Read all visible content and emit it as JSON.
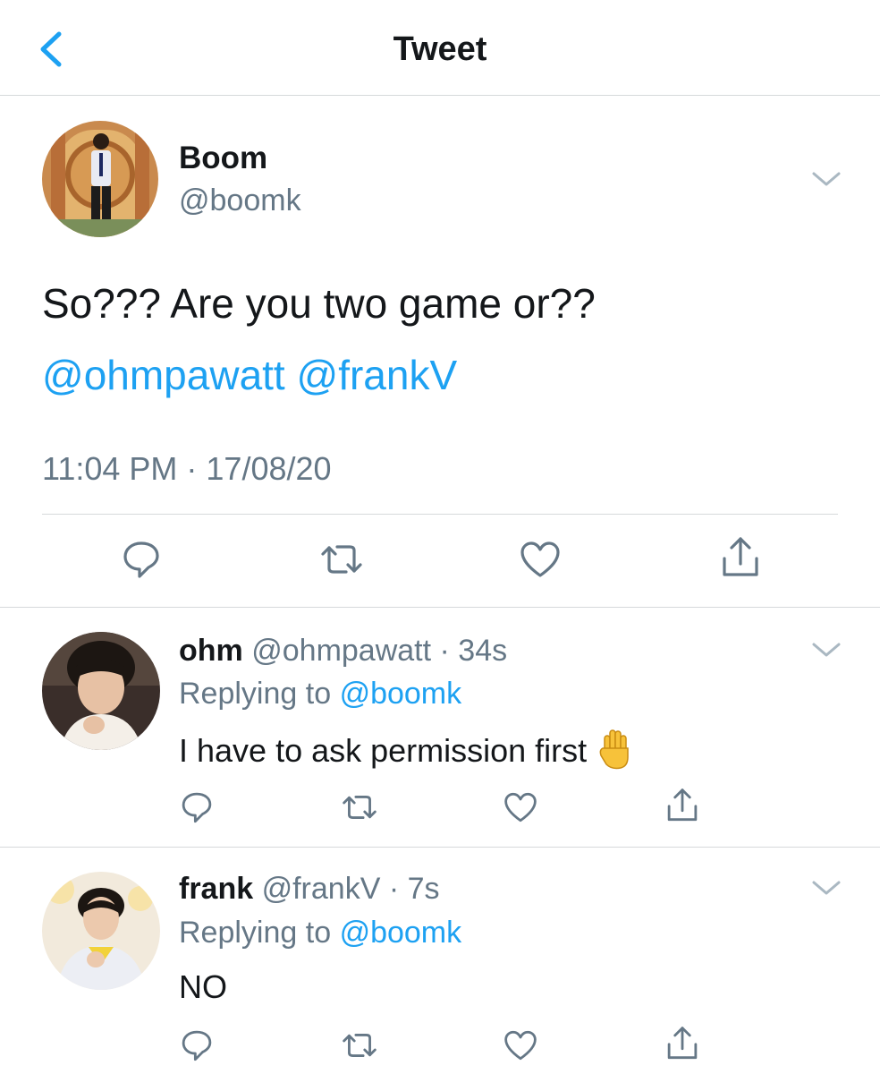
{
  "header": {
    "title": "Tweet",
    "back_icon": "chevron-left-icon"
  },
  "main_tweet": {
    "name": "Boom",
    "handle": "@boomk",
    "text": "So??? Are you two game or??",
    "mentions": [
      "@ohmpawatt",
      "@frankV"
    ],
    "timestamp": "11:04 PM · 17/08/20"
  },
  "actions": [
    "reply-icon",
    "retweet-icon",
    "like-icon",
    "share-icon"
  ],
  "replies": [
    {
      "name": "ohm",
      "handle": "@ohmpawatt",
      "time": "34s",
      "replying_label": "Replying to",
      "replying_to": "@boomk",
      "text": "I have to ask permission first",
      "emoji": "raised-hand-emoji"
    },
    {
      "name": "frank",
      "handle": "@frankV",
      "time": "7s",
      "replying_label": "Replying to",
      "replying_to": "@boomk",
      "text": "NO"
    }
  ],
  "colors": {
    "accent": "#1da1f2",
    "muted": "#657786",
    "text": "#14171a",
    "divider": "#d6d9db"
  }
}
